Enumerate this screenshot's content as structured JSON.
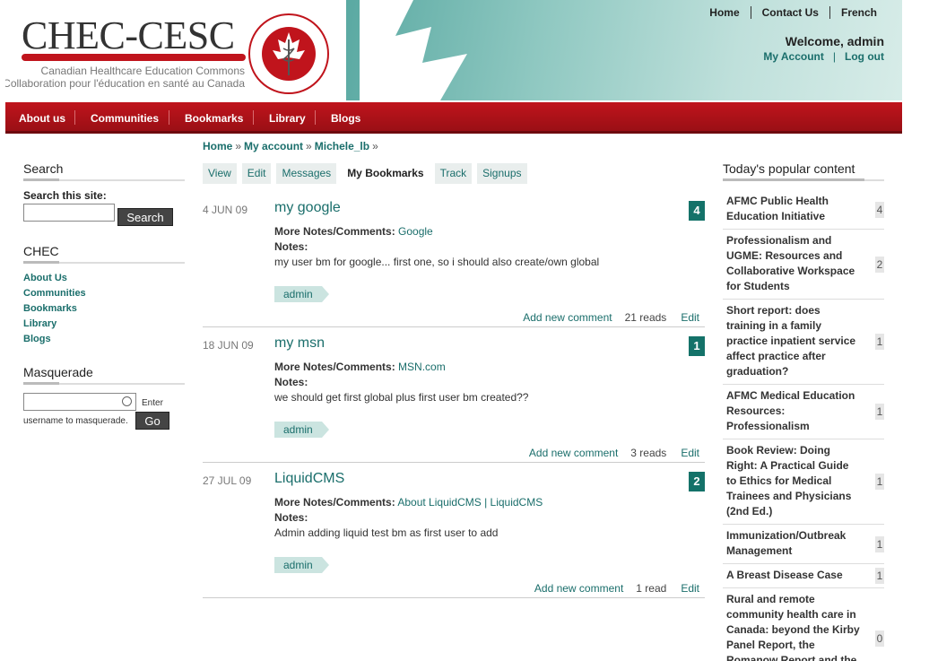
{
  "header": {
    "logo_text": "CHEC-CESC",
    "logo_sub_en": "Canadian Healthcare Education Commons",
    "logo_sub_fr": "Collaboration pour l'éducation en santé au Canada",
    "seal_text": "The Association of Faculties of Medicine of Canada · L'Association des facultés de médecine du Canada",
    "top_links": [
      "Home",
      "Contact Us",
      "French"
    ],
    "welcome": "Welcome, admin",
    "my_account": "My Account",
    "logout": "Log out"
  },
  "nav": [
    "About us",
    "Communities",
    "Bookmarks",
    "Library",
    "Blogs"
  ],
  "breadcrumb": [
    "Home",
    "My account",
    "Michele_lb"
  ],
  "tabs": [
    "View",
    "Edit",
    "Messages",
    "My Bookmarks",
    "Track",
    "Signups"
  ],
  "active_tab": "My Bookmarks",
  "left": {
    "search_title": "Search",
    "search_label": "Search this site:",
    "search_value": "",
    "search_button": "Search",
    "chec_title": "CHEC",
    "chec_links": [
      "About Us",
      "Communities",
      "Bookmarks",
      "Library",
      "Blogs"
    ],
    "masq_title": "Masquerade",
    "masq_value": "",
    "masq_hint_a": "Enter",
    "masq_hint_b": "username to masquerade.",
    "go_button": "Go"
  },
  "bookmarks": [
    {
      "date": "4 JUN 09",
      "title": "my google",
      "count": "4",
      "more_label": "More Notes/Comments:",
      "more_link": "Google",
      "notes_label": "Notes:",
      "notes": "my user bm for google... first one, so i should also create/own global",
      "tag": "admin",
      "add_comment": "Add new comment",
      "reads": "21 reads",
      "edit": "Edit"
    },
    {
      "date": "18 JUN 09",
      "title": "my msn",
      "count": "1",
      "more_label": "More Notes/Comments:",
      "more_link": "MSN.com",
      "notes_label": "Notes:",
      "notes": "we should get first global plus first user bm created??",
      "tag": "admin",
      "add_comment": "Add new comment",
      "reads": "3 reads",
      "edit": "Edit"
    },
    {
      "date": "27 JUL 09",
      "title": "LiquidCMS",
      "count": "2",
      "more_label": "More Notes/Comments:",
      "more_link": "About LiquidCMS | LiquidCMS",
      "notes_label": "Notes:",
      "notes": "Admin adding liquid test bm as first user to add",
      "tag": "admin",
      "add_comment": "Add new comment",
      "reads": "1 read",
      "edit": "Edit"
    }
  ],
  "popular": {
    "title": "Today's popular content",
    "items": [
      {
        "title": "AFMC Public Health Education Initiative",
        "count": "4"
      },
      {
        "title": "Professionalism and UGME: Resources and Collaborative Workspace for Students",
        "count": "2"
      },
      {
        "title": "Short report: does training in a family practice inpatient service affect practice after graduation?",
        "count": "1"
      },
      {
        "title": "AFMC Medical Education Resources: Professionalism",
        "count": "1"
      },
      {
        "title": "Book Review: Doing Right: A Practical Guide to Ethics for Medical Trainees and Physicians (2nd Ed.)",
        "count": "1"
      },
      {
        "title": "Immunization/Outbreak Management",
        "count": "1"
      },
      {
        "title": "A Breast Disease Case",
        "count": "1"
      },
      {
        "title": "Rural and remote community health care in Canada: beyond the Kirby Panel Report, the Romanow Report and the federal budget of",
        "count": "0"
      }
    ]
  },
  "colors": {
    "accent": "#1a6e6b",
    "brand_red": "#c0141c",
    "badge": "#147269"
  }
}
